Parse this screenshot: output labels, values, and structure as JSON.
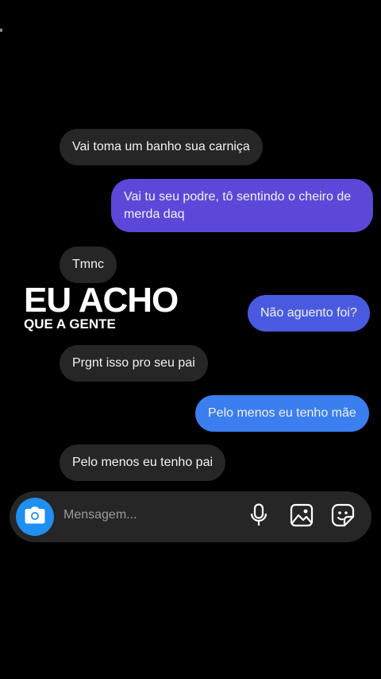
{
  "messages": [
    {
      "id": "b1",
      "direction": "incoming",
      "text": "Vai toma um banho sua carniça"
    },
    {
      "id": "b2",
      "direction": "outgoing",
      "text": "Vai tu seu podre, tô sentindo o cheiro de merda daq"
    },
    {
      "id": "b3",
      "direction": "incoming",
      "text": "Tmnc"
    },
    {
      "id": "b4",
      "direction": "outgoing",
      "text": "Não aguento foi?"
    },
    {
      "id": "b5",
      "direction": "incoming",
      "text": "Prgnt isso pro seu pai"
    },
    {
      "id": "b6",
      "direction": "outgoing",
      "text": "Pelo menos eu tenho mãe"
    },
    {
      "id": "b7",
      "direction": "incoming",
      "text": "Pelo menos eu tenho pai"
    }
  ],
  "overlay": {
    "headline": "EU ACHO",
    "subline": "QUE A GENTE"
  },
  "composer": {
    "placeholder": "Mensagem...",
    "icons": [
      "camera-icon",
      "microphone-icon",
      "gallery-icon",
      "sticker-icon"
    ]
  },
  "colors": {
    "incoming_bubble": "#262626",
    "outgoing_purple": "#5b48d9",
    "outgoing_indigo": "#4a5ae0",
    "outgoing_blue": "#3a7ef0",
    "camera_button": "#1f8ff0",
    "background": "#000000"
  }
}
